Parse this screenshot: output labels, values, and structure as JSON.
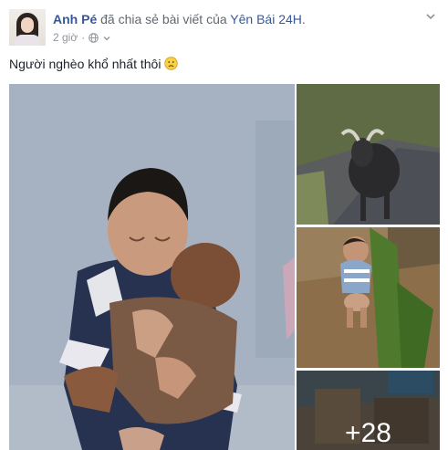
{
  "post": {
    "author": "Anh Pé",
    "action": "đã chia sẻ bài viết của",
    "page": "Yên Bái 24H",
    "punct": ".",
    "time": "2 giờ",
    "text": "Người nghèo khổ nhất thôi",
    "emoji_icon": "frown-emoji-icon",
    "privacy_icon": "globe-icon"
  },
  "photos": {
    "main_alt": "child hugging baby",
    "more_count": "+28"
  },
  "colors": {
    "link": "#365899",
    "meta": "#90949c",
    "text": "#1d2129"
  }
}
